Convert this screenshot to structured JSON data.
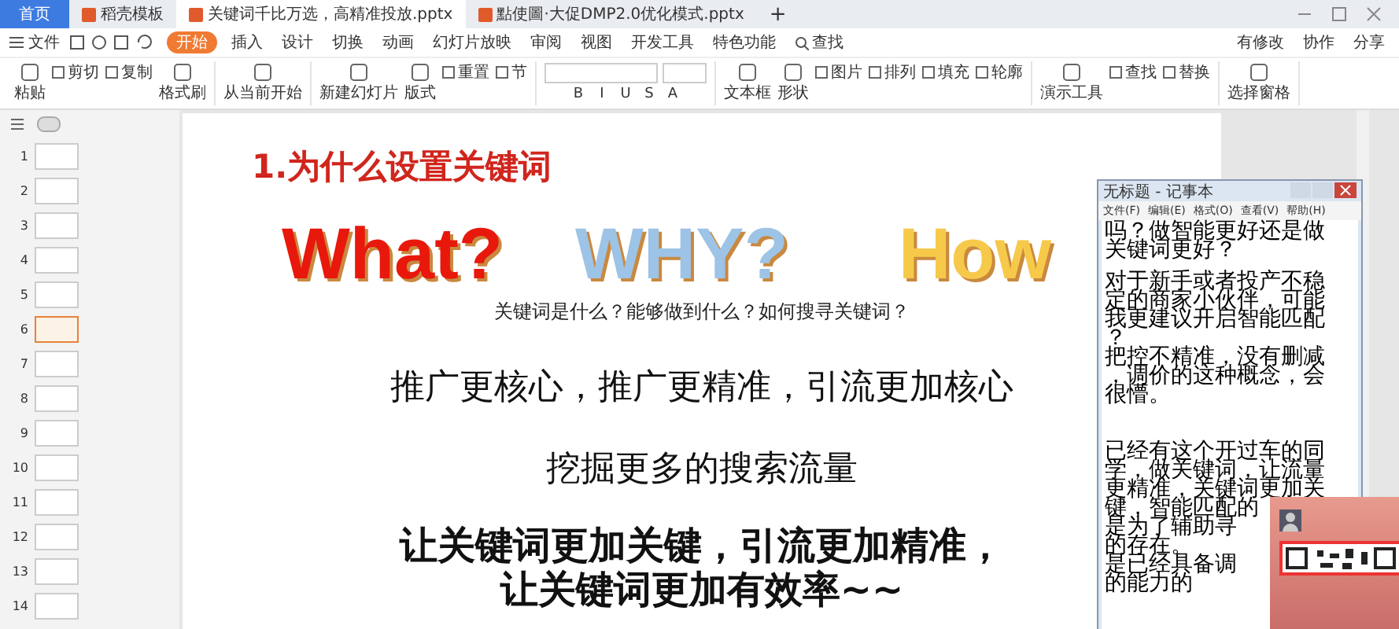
{
  "tabs": [
    {
      "label": "首页",
      "kind": "home",
      "selected": false
    },
    {
      "label": "稻壳模板",
      "kind": "doc",
      "selected": false
    },
    {
      "label": "关键词千比万选，高精准投放.pptx",
      "kind": "doc",
      "selected": true
    },
    {
      "label": "點使圖·大促DMP2.0优化模式.pptx",
      "kind": "doc",
      "selected": false
    }
  ],
  "new_tab": "+",
  "menu": {
    "file": "文件",
    "items": [
      {
        "label": "开始",
        "selected": true
      },
      {
        "label": "插入",
        "selected": false
      },
      {
        "label": "设计",
        "selected": false
      },
      {
        "label": "切换",
        "selected": false
      },
      {
        "label": "动画",
        "selected": false
      },
      {
        "label": "幻灯片放映",
        "selected": false
      },
      {
        "label": "审阅",
        "selected": false
      },
      {
        "label": "视图",
        "selected": false
      },
      {
        "label": "开发工具",
        "selected": false
      },
      {
        "label": "特色功能",
        "selected": false
      }
    ],
    "search": "查找",
    "right": [
      "有修改",
      "协作",
      "分享"
    ]
  },
  "ribbon": [
    [
      {
        "label": "粘贴",
        "kind": "big"
      },
      {
        "label": "剪切",
        "kind": "small"
      },
      {
        "label": "复制",
        "kind": "small"
      },
      {
        "label": "格式刷",
        "kind": "big"
      }
    ],
    [
      {
        "label": "从当前开始",
        "kind": "big"
      }
    ],
    [
      {
        "label": "新建幻灯片",
        "kind": "big"
      },
      {
        "label": "版式",
        "kind": "big"
      },
      {
        "label": "重置",
        "kind": "small"
      },
      {
        "label": "节",
        "kind": "small"
      }
    ],
    [
      {
        "label": "文本框",
        "kind": "big"
      },
      {
        "label": "形状",
        "kind": "big"
      },
      {
        "label": "图片",
        "kind": "small"
      },
      {
        "label": "排列",
        "kind": "small"
      },
      {
        "label": "填充",
        "kind": "small"
      },
      {
        "label": "轮廓",
        "kind": "small"
      }
    ],
    [
      {
        "label": "演示工具",
        "kind": "big"
      },
      {
        "label": "查找",
        "kind": "small"
      },
      {
        "label": "替换",
        "kind": "small"
      }
    ],
    [
      {
        "label": "选择窗格",
        "kind": "big"
      }
    ]
  ],
  "format_buttons": [
    "B",
    "I",
    "U",
    "S",
    "A"
  ],
  "thumbnails": [
    {
      "number": "1",
      "selected": false
    },
    {
      "number": "2",
      "selected": false
    },
    {
      "number": "3",
      "selected": false
    },
    {
      "number": "4",
      "selected": false
    },
    {
      "number": "5",
      "selected": false
    },
    {
      "number": "6",
      "selected": true
    },
    {
      "number": "7",
      "selected": false
    },
    {
      "number": "8",
      "selected": false
    },
    {
      "number": "9",
      "selected": false
    },
    {
      "number": "10",
      "selected": false
    },
    {
      "number": "11",
      "selected": false
    },
    {
      "number": "12",
      "selected": false
    },
    {
      "number": "13",
      "selected": false
    },
    {
      "number": "14",
      "selected": false
    }
  ],
  "slide": {
    "title": "1.为什么设置关键词",
    "big_words": [
      {
        "text": "What?",
        "color": "#e8180c"
      },
      {
        "text": "WHY?",
        "color": "#9dc3e6"
      },
      {
        "text": "How",
        "color": "#f6c94a"
      }
    ],
    "subtitle": "关键词是什么？能够做到什么？如何搜寻关键词？",
    "lines": [
      {
        "text": "推广更核心，推广更精准，引流更加核心",
        "kind": "normal"
      },
      {
        "text": "挖掘更多的搜索流量",
        "kind": "normal"
      },
      {
        "text": "让关键词更加关键，引流更加精准，",
        "kind": "bold"
      },
      {
        "text": "让关键词更加有效率~~",
        "kind": "bold"
      }
    ]
  },
  "notepad": {
    "title": "无标题 - 记事本",
    "menu": [
      "文件(F)",
      "编辑(E)",
      "格式(O)",
      "查看(V)",
      "帮助(H)"
    ],
    "paragraphs": [
      [
        "吗？做智能更好还是做",
        "关键词更好？"
      ],
      [
        "对于新手或者投产不稳",
        "定的商家小伙伴，可能",
        "我更建议开启智能匹配",
        "？",
        "把控不精准，没有删减",
        "，调价的这种概念，会",
        "很懵。"
      ],
      [
        "已经有这个开过车的同",
        "学，做关键词，让流量",
        "更精准，关键词更加关",
        "键，智能匹配的",
        "是为了辅助寻",
        "的存在。",
        "是已经具备调",
        "的能力的"
      ]
    ]
  }
}
